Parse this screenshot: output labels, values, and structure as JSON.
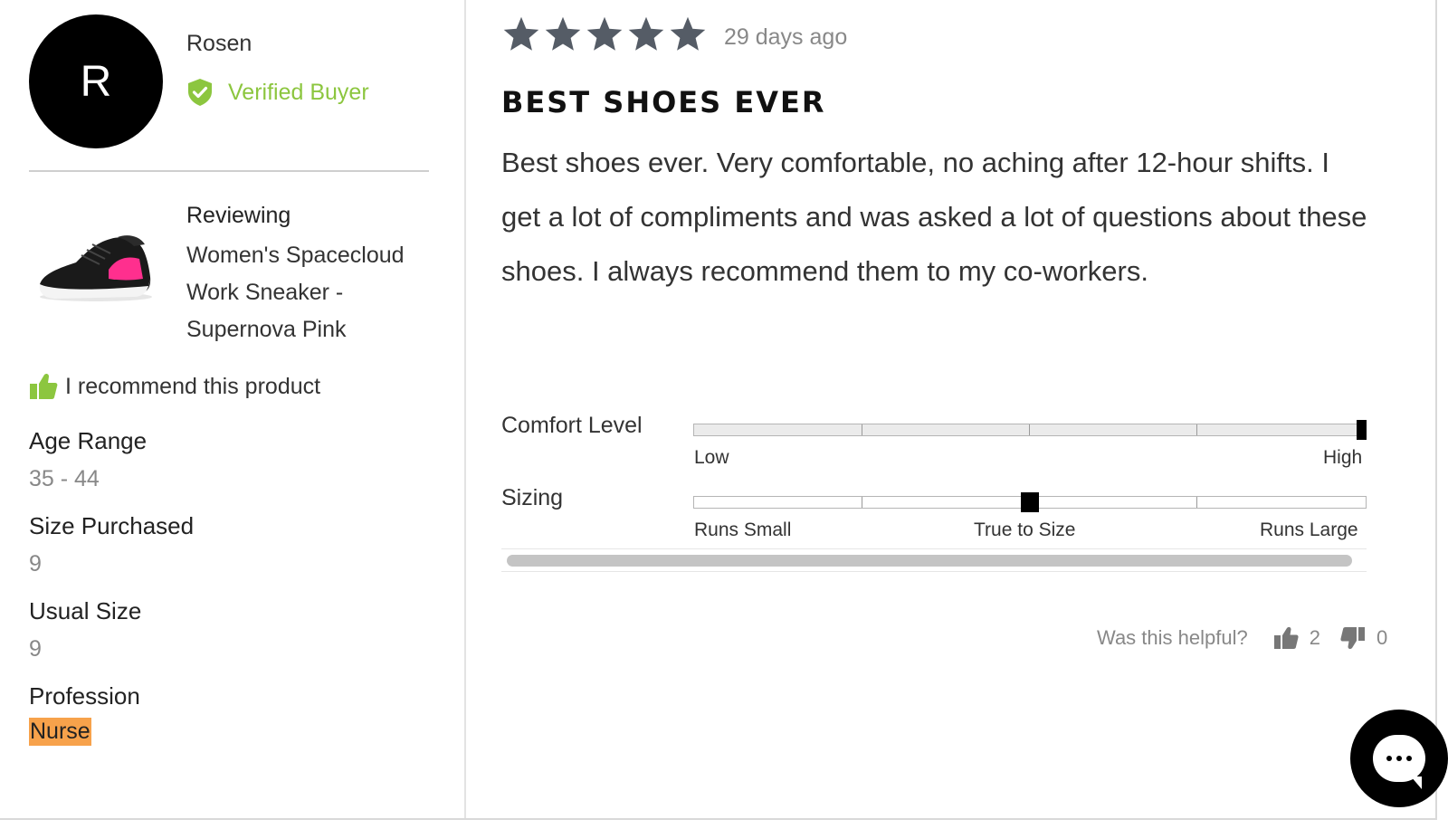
{
  "reviewer": {
    "initial": "R",
    "name": "Rosen",
    "verified_label": "Verified Buyer"
  },
  "product": {
    "reviewing_label": "Reviewing",
    "name": "Women's Spacecloud Work Sneaker - Supernova Pink"
  },
  "recommend_label": "I recommend this product",
  "attributes": {
    "age_range": {
      "label": "Age Range",
      "value": "35 - 44"
    },
    "size_purchased": {
      "label": "Size Purchased",
      "value": "9"
    },
    "usual_size": {
      "label": "Usual Size",
      "value": "9"
    },
    "profession": {
      "label": "Profession",
      "value": "Nurse"
    }
  },
  "review": {
    "rating": 5,
    "max_rating": 5,
    "date": "29 days ago",
    "title": "BEST SHOES EVER",
    "body": "Best shoes ever. Very comfortable, no aching after 12-hour shifts. I get a lot of compliments and was asked a lot of questions about these shoes. I always recommend them to my co-workers."
  },
  "scales": {
    "comfort": {
      "label": "Comfort Level",
      "low": "Low",
      "high": "High",
      "value": 1.0
    },
    "sizing": {
      "label": "Sizing",
      "low": "Runs Small",
      "mid": "True to Size",
      "high": "Runs Large",
      "value": 0.5
    }
  },
  "helpful": {
    "label": "Was this helpful?",
    "up_count": "2",
    "down_count": "0"
  },
  "icons": {
    "shield": "verified-shield-icon",
    "thumb": "thumbs-up-icon",
    "chat": "chat-bubble-icon"
  },
  "colors": {
    "verified_green": "#8cc63f",
    "star_gray": "#555c66",
    "profession_highlight": "#f7a24b"
  }
}
